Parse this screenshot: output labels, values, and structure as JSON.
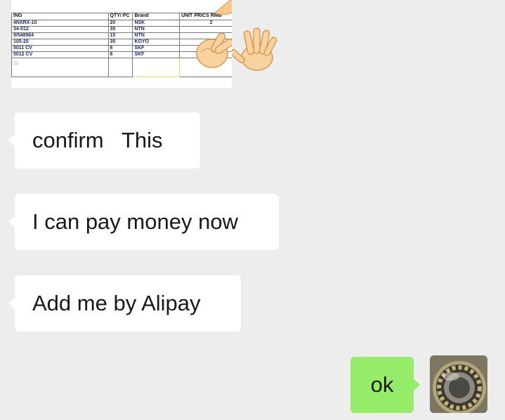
{
  "chat": {
    "spreadsheet": {
      "headers": [
        "ING",
        "QTY/ PC",
        "Brand",
        "UNIT PRICS RMB"
      ],
      "rows": [
        [
          "4NXRX-10",
          "20",
          "NSK",
          "2"
        ],
        [
          "34-012",
          "30",
          "NTN",
          ""
        ],
        [
          "9/548964",
          "15",
          "NTN",
          ""
        ],
        [
          "105-20",
          "30",
          "KOYO",
          ""
        ],
        [
          "5011 CV",
          "6",
          "SKF",
          ""
        ],
        [
          "5012 CV",
          "6",
          "SKF",
          ""
        ]
      ],
      "footer_note": "11"
    },
    "messages": [
      {
        "text": "confirm   This"
      },
      {
        "text": "I can pay money now"
      },
      {
        "text": "Add me by Alipay"
      },
      {
        "text": "ok"
      }
    ]
  }
}
